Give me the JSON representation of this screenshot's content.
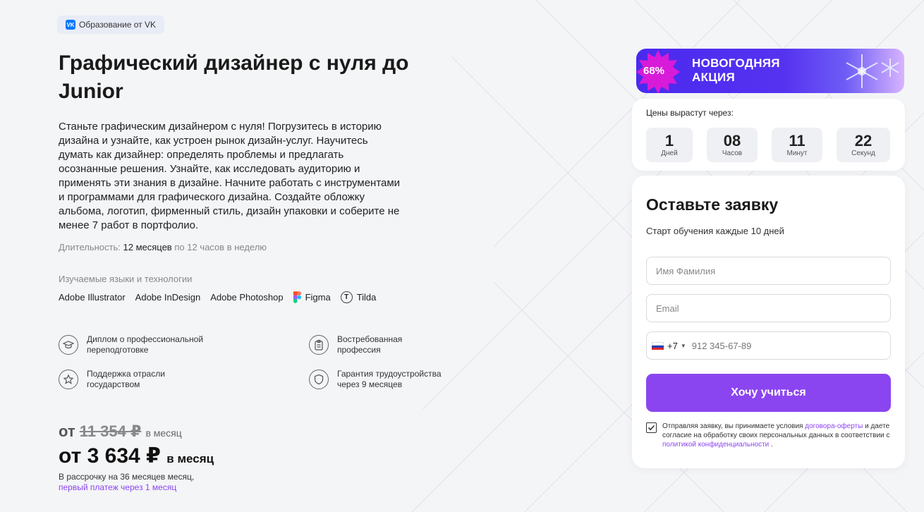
{
  "badge": {
    "logo": "VK",
    "label": "Образование от VK"
  },
  "course": {
    "title": "Графический дизайнер с нуля до Junior",
    "description": "Станьте графическим дизайнером с нуля! Погрузитесь в историю дизайна и узнайте, как устроен рынок дизайн-услуг. Научитесь думать как дизайнер: определять проблемы и предлагать осознанные решения. Узнайте, как исследовать аудиторию и применять эти знания в дизайне. Начните работать с инструментами и программами для графического дизайна. Создайте обложку альбома, логотип, фирменный стиль, дизайн упаковки и соберите не менее 7 работ в портфолио.",
    "duration_label": "Длительность:",
    "duration_value": "12 месяцев",
    "duration_suffix": "по 12 часов в неделю"
  },
  "tech": {
    "title": "Изучаемые языки и технологии",
    "items": [
      {
        "label": "Adobe Illustrator",
        "icon": ""
      },
      {
        "label": "Adobe InDesign",
        "icon": ""
      },
      {
        "label": "Adobe Photoshop",
        "icon": ""
      },
      {
        "label": "Figma",
        "icon": "figma-icon"
      },
      {
        "label": "Tilda",
        "icon": "tilda-icon"
      }
    ],
    "tilda_glyph": "T"
  },
  "features": [
    {
      "label": "Диплом о профессиональной переподготовке",
      "icon": "graduation-cap-icon"
    },
    {
      "label": "Востребованная профессия",
      "icon": "clipboard-icon"
    },
    {
      "label": "Поддержка отрасли государством",
      "icon": "star-icon"
    },
    {
      "label": "Гарантия трудоустройства через 9 месяцев",
      "icon": "shield-icon"
    }
  ],
  "pricing": {
    "old_prefix": "от",
    "old_price": "11 354",
    "old_currency": "₽",
    "old_period": "в месяц",
    "new_prefix": "от",
    "new_price": "3 634",
    "new_currency": "₽",
    "new_period": "в месяц",
    "installment_line1": "В рассрочку на 36 месяцев месяц,",
    "installment_link": "первый платеж через 1 месяц"
  },
  "promo": {
    "discount": "68%",
    "title_line1": "НОВОГОДНЯЯ",
    "title_line2": "АКЦИЯ"
  },
  "timer": {
    "label": "Цены вырастут через:",
    "units": [
      {
        "value": "1",
        "label": "Дней"
      },
      {
        "value": "08",
        "label": "Часов"
      },
      {
        "value": "11",
        "label": "Минут"
      },
      {
        "value": "22",
        "label": "Секунд"
      }
    ]
  },
  "form": {
    "title": "Оставьте заявку",
    "subtitle": "Старт обучения каждые 10 дней",
    "name_placeholder": "Имя Фамилия",
    "email_placeholder": "Email",
    "phone_code": "+7",
    "phone_placeholder": "912 345-67-89",
    "submit_label": "Хочу учиться",
    "consent_part1": "Отправляя заявку, вы принимаете условия",
    "consent_link1": "договора-оферты",
    "consent_part2": "и даете согласие на обработку своих персональных данных в соответствии с",
    "consent_link2": "политикой конфиденциальности",
    "consent_end": "."
  },
  "colors": {
    "accent": "#8b45f0",
    "promo_blue": "#4a2aef",
    "promo_burst": "#d81bd8",
    "vk_blue": "#0077ff"
  }
}
